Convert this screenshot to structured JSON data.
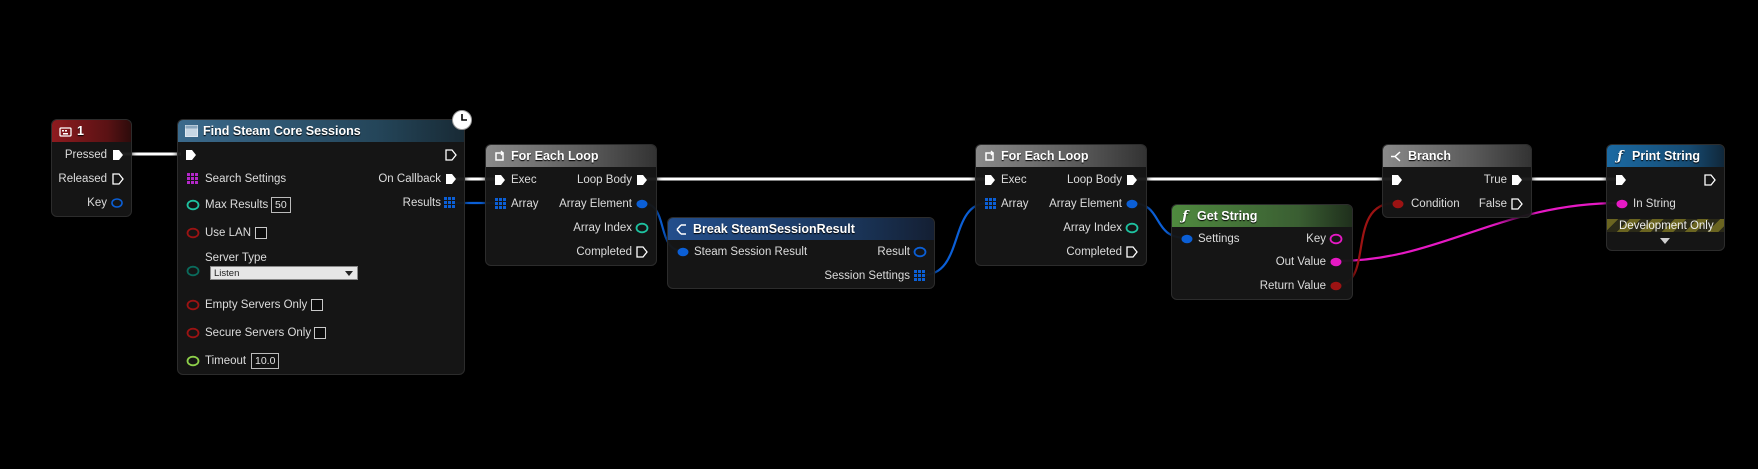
{
  "colors": {
    "exec": "#ffffff",
    "struct": "#0b5fd6",
    "int": "#1ec2a0",
    "bool": "#9c1313",
    "float": "#8ed04a",
    "string": "#e619c4",
    "struct_settings": "#0b5fd6"
  },
  "nodes": {
    "key1": {
      "title": "1",
      "pressed": "Pressed",
      "released": "Released",
      "key": "Key"
    },
    "find": {
      "title": "Find Steam Core Sessions",
      "search_settings": "Search Settings",
      "on_callback": "On Callback",
      "results": "Results",
      "max_results": "Max Results",
      "max_results_value": "50",
      "use_lan": "Use LAN",
      "server_type": "Server Type",
      "server_type_value": "Listen",
      "empty_servers": "Empty Servers Only",
      "secure_servers": "Secure Servers Only",
      "timeout": "Timeout",
      "timeout_value": "10.0"
    },
    "loop1": {
      "title": "For Each Loop",
      "exec": "Exec",
      "loop_body": "Loop Body",
      "array": "Array",
      "array_element": "Array Element",
      "array_index": "Array Index",
      "completed": "Completed"
    },
    "breakres": {
      "title": "Break SteamSessionResult",
      "input": "Steam Session Result",
      "result": "Result",
      "session_settings": "Session Settings"
    },
    "loop2": {
      "title": "For Each Loop",
      "exec": "Exec",
      "loop_body": "Loop Body",
      "array": "Array",
      "array_element": "Array Element",
      "array_index": "Array Index",
      "completed": "Completed"
    },
    "getstring": {
      "title": "Get String",
      "settings": "Settings",
      "key": "Key",
      "out_value": "Out Value",
      "return_value": "Return Value"
    },
    "branch": {
      "title": "Branch",
      "condition": "Condition",
      "true": "True",
      "false": "False"
    },
    "print": {
      "title": "Print String",
      "in_string": "In String",
      "dev_only": "Development Only"
    }
  }
}
